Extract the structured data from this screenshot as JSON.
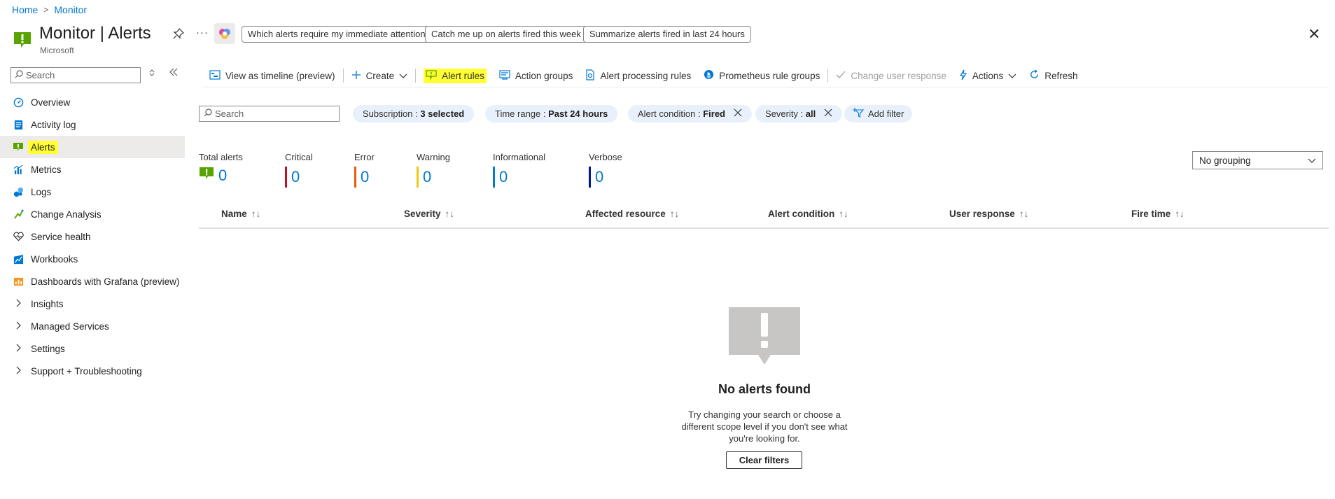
{
  "breadcrumb": {
    "home": "Home",
    "monitor": "Monitor",
    "separator": ">"
  },
  "header": {
    "title_main": "Monitor",
    "title_sep": " | ",
    "title_page": "Alerts",
    "subtitle": "Microsoft",
    "pin_icon": "pin-icon",
    "more_icon": "ellipsis-icon",
    "ellipsis": "···",
    "copilot_icon": "copilot-icon",
    "prompts": [
      "Which alerts require my immediate attention",
      "Catch me up on alerts fired this week",
      "Summarize alerts fired in last 24 hours"
    ],
    "close": "✕"
  },
  "nav": {
    "search_placeholder": "Search",
    "items": [
      {
        "label": "Overview",
        "icon": "overview-icon",
        "color": "#0078d4"
      },
      {
        "label": "Activity log",
        "icon": "activity-log-icon",
        "color": "#0078d4"
      },
      {
        "label": "Alerts",
        "icon": "alerts-icon",
        "color": "#57a300",
        "selected": true
      },
      {
        "label": "Metrics",
        "icon": "metrics-icon",
        "color": "#0078d4"
      },
      {
        "label": "Logs",
        "icon": "logs-icon",
        "color": "#0078d4"
      },
      {
        "label": "Change Analysis",
        "icon": "change-analysis-icon",
        "color": "#57a300"
      },
      {
        "label": "Service health",
        "icon": "service-health-icon",
        "color": "#323130"
      },
      {
        "label": "Workbooks",
        "icon": "workbooks-icon",
        "color": "#0078d4"
      },
      {
        "label": "Dashboards with Grafana (preview)",
        "icon": "grafana-icon",
        "color": "#f7941d"
      },
      {
        "label": "Insights",
        "icon": "chevron-right-icon",
        "expandable": true
      },
      {
        "label": "Managed Services",
        "icon": "chevron-right-icon",
        "expandable": true
      },
      {
        "label": "Settings",
        "icon": "chevron-right-icon",
        "expandable": true
      },
      {
        "label": "Support + Troubleshooting",
        "icon": "chevron-right-icon",
        "expandable": true
      }
    ]
  },
  "toolbar": {
    "timeline": "View as timeline (preview)",
    "create": "Create",
    "alert_rules": "Alert rules",
    "action_groups": "Action groups",
    "alert_processing_rules": "Alert processing rules",
    "prometheus_rule_groups": "Prometheus rule groups",
    "change_user_response": "Change user response",
    "actions": "Actions",
    "refresh": "Refresh"
  },
  "filters": {
    "search_placeholder": "Search",
    "subscription_label": "Subscription : ",
    "subscription_value": "3 selected",
    "time_range_label": "Time range : ",
    "time_range_value": "Past 24 hours",
    "alert_condition_label": "Alert condition : ",
    "alert_condition_value": "Fired",
    "severity_label": "Severity : ",
    "severity_value": "all",
    "add_filter": "Add filter"
  },
  "summary": {
    "total": {
      "label": "Total alerts",
      "value": "0"
    },
    "critical": {
      "label": "Critical",
      "value": "0",
      "color": "#c50f1f"
    },
    "error": {
      "label": "Error",
      "value": "0",
      "color": "#e8590c"
    },
    "warning": {
      "label": "Warning",
      "value": "0",
      "color": "#f2c811"
    },
    "informational": {
      "label": "Informational",
      "value": "0",
      "color": "#0078d4"
    },
    "verbose": {
      "label": "Verbose",
      "value": "0",
      "color": "#00188f"
    }
  },
  "grouping": {
    "selected": "No grouping"
  },
  "table": {
    "columns": [
      "Name",
      "Severity",
      "Affected resource",
      "Alert condition",
      "User response",
      "Fire time"
    ],
    "sort_glyph": "↑↓"
  },
  "empty": {
    "title": "No alerts found",
    "description": "Try changing your search or choose a different scope level if you don't see what you're looking for.",
    "button": "Clear filters"
  }
}
